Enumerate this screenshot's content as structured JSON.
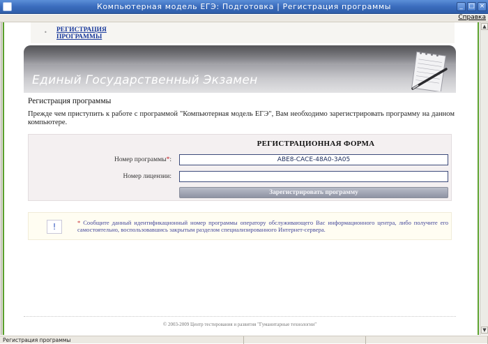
{
  "window": {
    "title": "Компьютерная модель ЕГЭ: Подготовка | Регистрация программы",
    "minimize_glyph": "_",
    "maximize_glyph": "□",
    "close_glyph": "×"
  },
  "menu": {
    "help": "Справка"
  },
  "breadcrumb": {
    "bullet": "•",
    "link": "РЕГИСТРАЦИЯ ПРОГРАММЫ"
  },
  "banner": {
    "headline": "Единый Государственный Экзамен"
  },
  "page": {
    "title": "Регистрация программы",
    "intro": "Прежде чем приступить к работе с программой \"Компьютерная модель ЕГЭ\", Вам необходимо зарегистрировать программу на данном компьютере."
  },
  "form": {
    "title": "РЕГИСТРАЦИОННАЯ ФОРМА",
    "program_number_label": "Номер программы",
    "required_mark": "*",
    "label_colon": ":",
    "program_number_value": "ABE8-CACE-48A0-3A05",
    "license_number_label": "Номер лицензии:",
    "license_number_value": "",
    "submit_label": "Зарегистрировать программу"
  },
  "note": {
    "icon_glyph": "!",
    "star": "*",
    "text": "Сообщите данный идентификационный номер программы оператору обслуживающего Вас информационного центра, либо получите его самостоятельно, воспользовавшись закрытым разделом специализированного Интернет-сервера."
  },
  "footer": {
    "copyright": "© 2003-2009 Центр тестирования и развития \"Гуманитарные технологии\""
  },
  "status": {
    "text": "Регистрация программы"
  },
  "scroll": {
    "up_glyph": "▲",
    "down_glyph": "▼"
  },
  "colors": {
    "accent_green": "#5aa02c",
    "titlebar_blue": "#3a6cbd",
    "required_red": "#c0181e",
    "link_blue": "#1a3a9c"
  }
}
